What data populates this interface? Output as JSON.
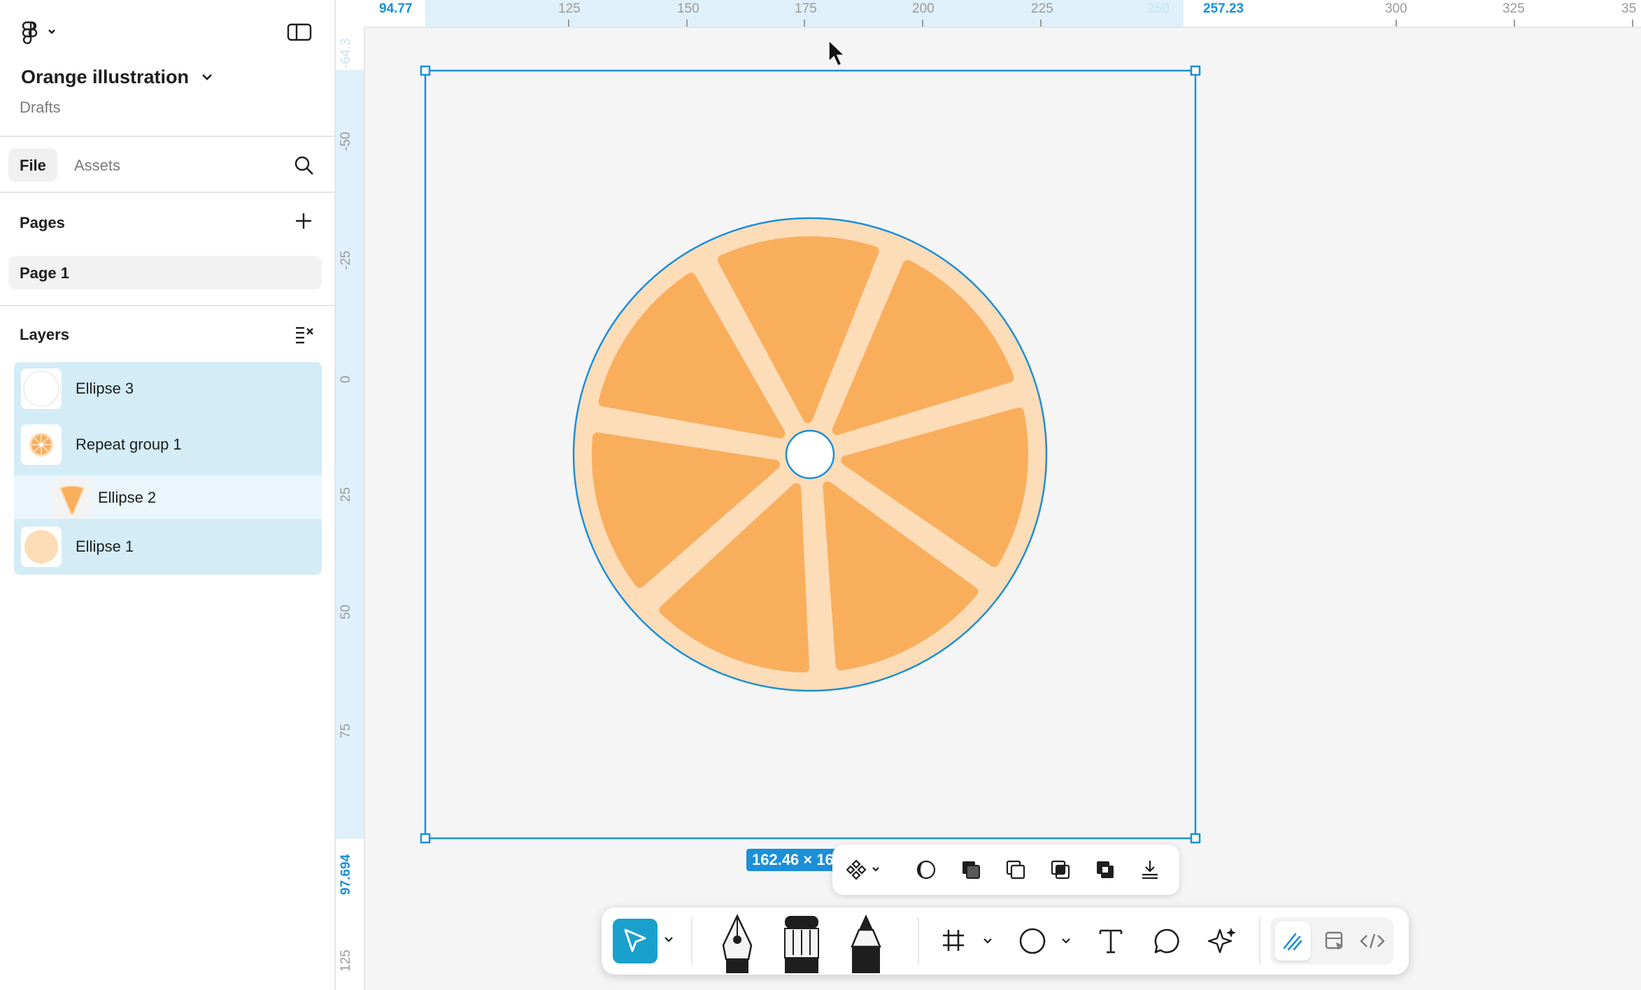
{
  "app": {
    "file_name": "Orange illustration",
    "location": "Drafts",
    "menu_icon": "figma-logo-icon",
    "toggle_sidebar_icon": "sidebar-toggle-icon"
  },
  "sidebar": {
    "tabs": [
      {
        "label": "File",
        "active": true
      },
      {
        "label": "Assets",
        "active": false
      }
    ],
    "pages_heading": "Pages",
    "pages": [
      {
        "label": "Page 1",
        "selected": true
      }
    ],
    "layers_heading": "Layers",
    "layers": [
      {
        "label": "Ellipse 3",
        "indent": 0,
        "selected": true,
        "thumb": "white-circle"
      },
      {
        "label": "Repeat group 1",
        "indent": 0,
        "selected": true,
        "thumb": "orange-slice"
      },
      {
        "label": "Ellipse 2",
        "indent": 1,
        "selected": false,
        "thumb": "orange-wedge"
      },
      {
        "label": "Ellipse 1",
        "indent": 0,
        "selected": true,
        "thumb": "peach-circle"
      }
    ]
  },
  "rulers": {
    "horizontal": [
      "94.77",
      "125",
      "150",
      "175",
      "200",
      "225",
      "250",
      "257.23",
      "300",
      "325",
      "35"
    ],
    "vertical": [
      "-64.3",
      "-50",
      "-25",
      "0",
      "25",
      "50",
      "75",
      "97.694",
      "125"
    ]
  },
  "selection": {
    "size_label": "162.46 × 16"
  },
  "colors": {
    "selection_blue": "#1b8fd8",
    "peel": "#fddcb8",
    "segment": "#f9ae5c",
    "layer_selected": "#d3ecf6",
    "layer_child": "#eaf6fb",
    "tool_active": "#1aa0cc"
  },
  "context_toolbar": [
    "component-icon",
    "mask-icon",
    "union-icon",
    "subtract-icon",
    "intersect-icon",
    "exclude-icon",
    "flatten-icon"
  ],
  "main_toolbar": [
    "move-tool-icon",
    "pen-icon",
    "brush-icon",
    "pencil-icon",
    "frame-icon",
    "ellipse-icon",
    "text-icon",
    "comment-icon",
    "ai-sparkle-icon",
    "draw-mode-icon",
    "design-mode-icon",
    "dev-mode-icon"
  ]
}
